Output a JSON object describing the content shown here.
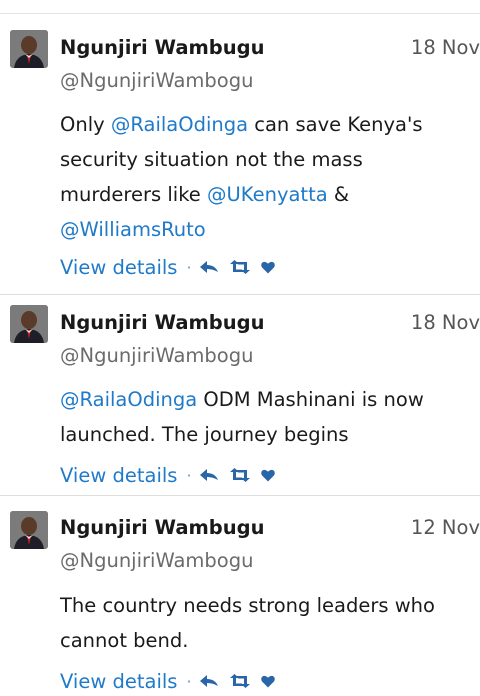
{
  "tweets": [
    {
      "author": "Ngunjiri Wambugu",
      "date": "18 Nov",
      "handle": "@NgunjiriWambogu",
      "text_parts": [
        {
          "t": "Only "
        },
        {
          "t": "@RailaOdinga",
          "mention": true
        },
        {
          "t": " can save Kenya's security situation not the mass murderers like "
        },
        {
          "t": "@UKenyatta",
          "mention": true
        },
        {
          "t": " & "
        },
        {
          "t": "@WilliamsRuto",
          "mention": true
        }
      ],
      "view_details": "View details"
    },
    {
      "author": "Ngunjiri Wambugu",
      "date": "18 Nov",
      "handle": "@NgunjiriWambogu",
      "text_parts": [
        {
          "t": "@RailaOdinga",
          "mention": true
        },
        {
          "t": " ODM Mashinani is now launched. The journey begins"
        }
      ],
      "view_details": "View details"
    },
    {
      "author": "Ngunjiri Wambugu",
      "date": "12 Nov",
      "handle": "@NgunjiriWambogu",
      "text_parts": [
        {
          "t": "The country needs strong leaders who cannot bend."
        }
      ],
      "view_details": "View details"
    }
  ],
  "separator": "·",
  "icons": {
    "reply": "reply-icon",
    "retweet": "retweet-icon",
    "favorite": "heart-icon",
    "avatar": "avatar"
  },
  "colors": {
    "link": "#1f7ac9",
    "icon": "#2a65a8",
    "muted": "#6b6b6b"
  }
}
